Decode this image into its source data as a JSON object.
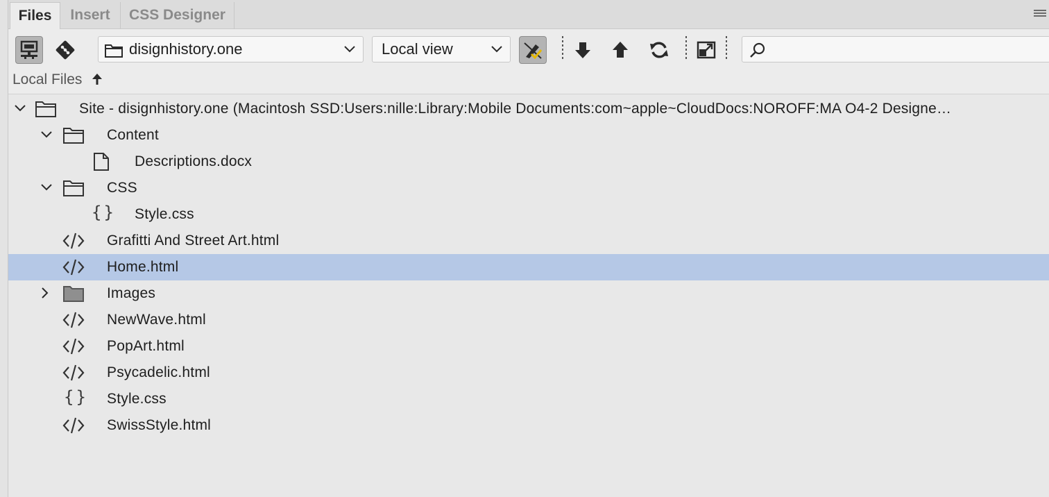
{
  "tabs": [
    "Files",
    "Insert",
    "CSS Designer"
  ],
  "toolbar": {
    "site_select": "disignhistory.one",
    "view_select": "Local view",
    "search_placeholder": "",
    "icons": {
      "connect": "connect-to-remote-icon",
      "git": "git-icon",
      "check": "check-in-out-icon",
      "get": "get-down-arrow-icon",
      "put": "put-up-arrow-icon",
      "refresh": "refresh-icon",
      "expand": "expand-panel-icon",
      "search": "search-icon"
    }
  },
  "column_header": {
    "label": "Local Files",
    "sort": "ascending"
  },
  "tree": {
    "rows": [
      {
        "name": "Site - disignhistory.one (Macintosh SSD:Users:nille:Library:Mobile Documents:com~apple~CloudDocs:NOROFF:MA O4-2 Designe…",
        "type": "site",
        "expanded": true
      },
      {
        "name": "Content",
        "type": "folder",
        "expanded": true
      },
      {
        "name": "Descriptions.docx",
        "type": "doc"
      },
      {
        "name": "CSS",
        "type": "folder",
        "expanded": true
      },
      {
        "name": "Style.css",
        "type": "css"
      },
      {
        "name": "Grafitti And Street Art.html",
        "type": "html"
      },
      {
        "name": "Home.html",
        "type": "html",
        "selected": true
      },
      {
        "name": "Images",
        "type": "folder",
        "expanded": false
      },
      {
        "name": "NewWave.html",
        "type": "html"
      },
      {
        "name": "PopArt.html",
        "type": "html"
      },
      {
        "name": "Psycadelic.html",
        "type": "html"
      },
      {
        "name": "Style.css",
        "type": "css"
      },
      {
        "name": "SwissStyle.html",
        "type": "html"
      }
    ]
  },
  "colors": {
    "selection": "#b5c8e6",
    "panel": "#e8e8e8",
    "tabbar": "#dcdcdc"
  }
}
